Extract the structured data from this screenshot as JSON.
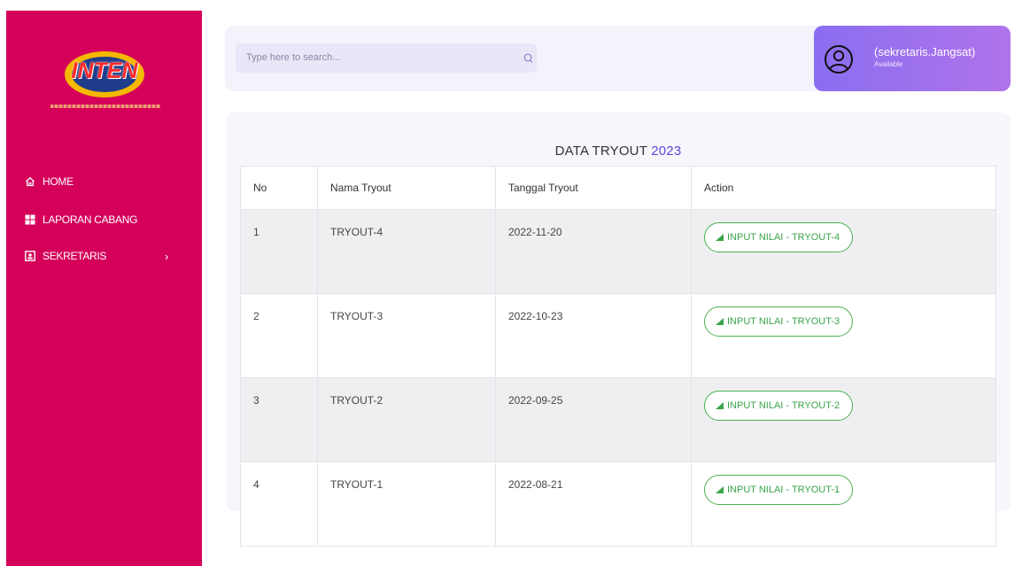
{
  "brand": {
    "logo_text": "INTEN"
  },
  "sidebar": {
    "items": [
      {
        "label": "HOME",
        "icon": "home-icon"
      },
      {
        "label": "LAPORAN CABANG",
        "icon": "grid-icon"
      },
      {
        "label": "SEKRETARIS",
        "icon": "id-card-icon",
        "chevron": "›"
      }
    ]
  },
  "search": {
    "placeholder": "Type here to search..."
  },
  "user": {
    "name": "(sekretaris.Jangsat)",
    "status": "Available"
  },
  "panel": {
    "title": "DATA TRYOUT",
    "year": "2023"
  },
  "table": {
    "headers": [
      "No",
      "Nama Tryout",
      "Tanggal Tryout",
      "Action"
    ],
    "rows": [
      {
        "no": "1",
        "nama": "TRYOUT-4",
        "tanggal": "2022-11-20",
        "action": "INPUT NILAI - TRYOUT-4"
      },
      {
        "no": "2",
        "nama": "TRYOUT-3",
        "tanggal": "2022-10-23",
        "action": "INPUT NILAI - TRYOUT-3"
      },
      {
        "no": "3",
        "nama": "TRYOUT-2",
        "tanggal": "2022-09-25",
        "action": "INPUT NILAI - TRYOUT-2"
      },
      {
        "no": "4",
        "nama": "TRYOUT-1",
        "tanggal": "2022-08-21",
        "action": "INPUT NILAI - TRYOUT-1"
      }
    ]
  },
  "colors": {
    "sidebar": "#d4005a",
    "accent": "#5a4ad6",
    "user_card": "#9a70ee",
    "action": "#3aa44a"
  }
}
